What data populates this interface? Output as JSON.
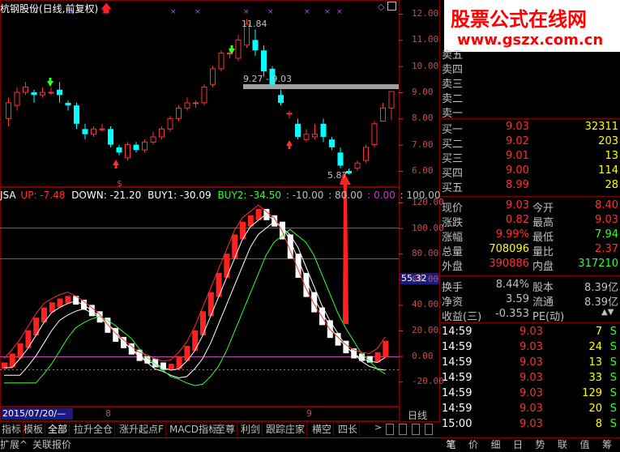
{
  "header": {
    "title": "杭钢股份(日线,前复权)"
  },
  "watermark": {
    "cn": "股票公式在线网",
    "url": "www.gszx.com.cn"
  },
  "indicator": {
    "name": "JSA",
    "up": "UP: -7.48",
    "down": "DOWN: -21.20",
    "buy1": "BUY1: -30.09",
    "buy2": "BUY2: -34.50",
    "p1": ": -10.00",
    "p2": ": 80.00",
    "p3": ": 0.00",
    "p4": ": 100.00"
  },
  "annotations": {
    "high": "11.84",
    "range": "9.27 - 9.03",
    "low": "5.87"
  },
  "price_axis": [
    "12.00",
    "11.00",
    "10.00",
    "9.00",
    "8.00",
    "7.00",
    "6.00"
  ],
  "ind_axis": [
    "120.00",
    "100.00",
    "80.00",
    "60.00",
    "40.00",
    "20.00",
    "0.00",
    "-20.00"
  ],
  "crosshair_value": "55.32",
  "date_axis": {
    "date": "2015/07/20/—",
    "m8": "8",
    "m9": "9",
    "period": "日线"
  },
  "orderbook": {
    "sells": [
      {
        "label": "卖五",
        "price": "",
        "vol": ""
      },
      {
        "label": "卖四",
        "price": "",
        "vol": ""
      },
      {
        "label": "卖三",
        "price": "",
        "vol": ""
      },
      {
        "label": "卖二",
        "price": "",
        "vol": ""
      },
      {
        "label": "卖一",
        "price": "",
        "vol": ""
      }
    ],
    "buys": [
      {
        "label": "买一",
        "price": "9.03",
        "vol": "32311"
      },
      {
        "label": "买二",
        "price": "9.02",
        "vol": "203"
      },
      {
        "label": "买三",
        "price": "9.01",
        "vol": "13"
      },
      {
        "label": "买四",
        "price": "9.00",
        "vol": "114"
      },
      {
        "label": "买五",
        "price": "8.99",
        "vol": "28"
      }
    ]
  },
  "quote": [
    {
      "l1": "现价",
      "v1": "9.03",
      "l2": "今开",
      "v2": "8.40",
      "c1": "#ff3030",
      "c2": "#ff3030"
    },
    {
      "l1": "涨跌",
      "v1": "0.82",
      "l2": "最高",
      "v2": "9.03",
      "c1": "#ff3030",
      "c2": "#ff3030"
    },
    {
      "l1": "涨幅",
      "v1": "9.99%",
      "l2": "最低",
      "v2": "7.94",
      "c1": "#ff3030",
      "c2": "#30ff30"
    },
    {
      "l1": "总量",
      "v1": "708096",
      "l2": "量比",
      "v2": "2.37",
      "c1": "#ffff00",
      "c2": "#ff3030"
    },
    {
      "l1": "外盘",
      "v1": "390886",
      "l2": "内盘",
      "v2": "317210",
      "c1": "#ff3030",
      "c2": "#30ff30"
    }
  ],
  "fundamentals": [
    {
      "l1": "换手",
      "v1": "8.44%",
      "l2": "股本",
      "v2": "8.39亿"
    },
    {
      "l1": "净资",
      "v1": "3.59",
      "l2": "流通",
      "v2": "8.39亿"
    },
    {
      "l1": "收益(三)",
      "v1": "-0.353",
      "l2": "PE(动)",
      "v2": ""
    }
  ],
  "ticks": [
    {
      "time": "14:59",
      "price": "9.03",
      "vol": "7",
      "side": "S"
    },
    {
      "time": "14:59",
      "price": "9.03",
      "vol": "24",
      "side": "S"
    },
    {
      "time": "14:59",
      "price": "9.03",
      "vol": "13",
      "side": "S"
    },
    {
      "time": "14:59",
      "price": "9.03",
      "vol": "33",
      "side": "S"
    },
    {
      "time": "14:59",
      "price": "9.03",
      "vol": "129",
      "side": "S"
    },
    {
      "time": "14:59",
      "price": "9.03",
      "vol": "20",
      "side": "S"
    },
    {
      "time": "15:00",
      "price": "9.03",
      "vol": "8",
      "side": "S"
    }
  ],
  "tabs": [
    "指标",
    "模板",
    "全部",
    "拉升全仓",
    "涨升起点F",
    "MACD指标",
    "至尊",
    "利剑",
    "跟踪庄家",
    "横空",
    "四长"
  ],
  "bottom_tabs": [
    "扩展^",
    "关联报价"
  ],
  "right_tabs": [
    "笔",
    "价",
    "细",
    "日",
    "势",
    "联",
    "值",
    "筹"
  ],
  "colors": {
    "up": "#ff3030",
    "down": "#00ffff",
    "bg": "#000000",
    "grid": "#800000"
  }
}
